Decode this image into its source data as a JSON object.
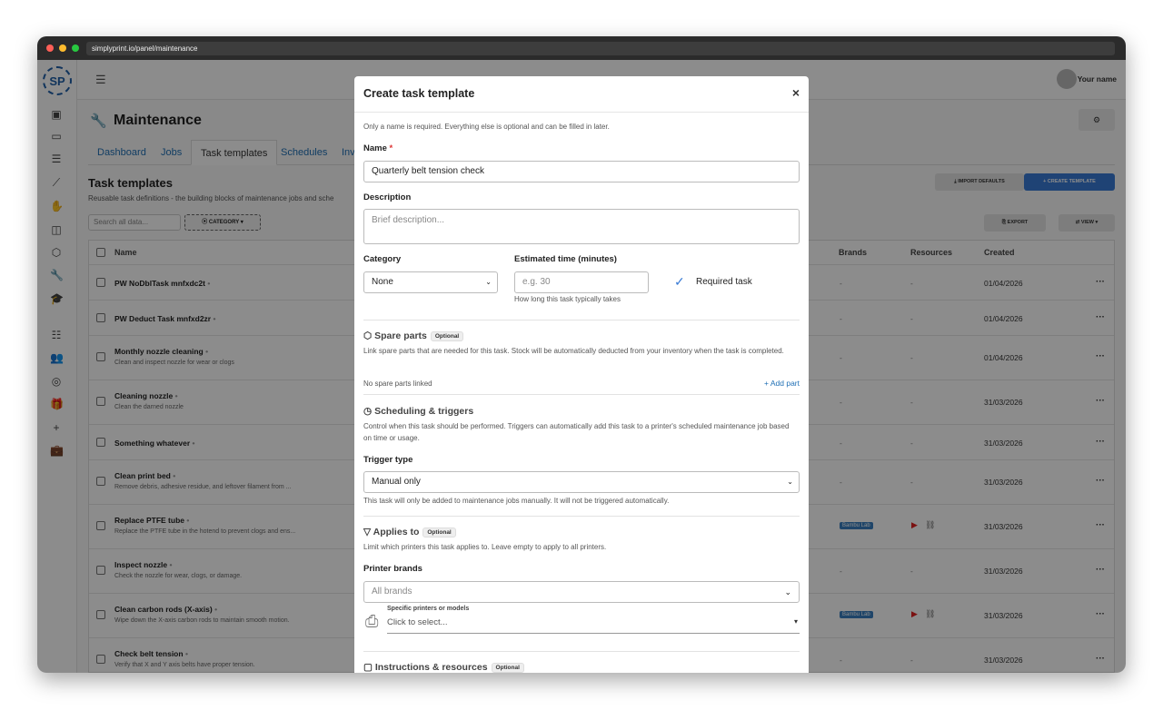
{
  "browser": {
    "url": "simplyprint.io/panel/maintenance"
  },
  "logo": {
    "text": "SP"
  },
  "topbar": {
    "user_name": "Your name"
  },
  "page": {
    "title": "Maintenance",
    "tabs": [
      "Dashboard",
      "Jobs",
      "Task templates",
      "Schedules",
      "Inv"
    ],
    "section_title": "Task templates",
    "section_subtitle": "Reusable task definitions - the building blocks of maintenance jobs and sche",
    "search_placeholder": "Search all data...",
    "category_button": "CATEGORY",
    "import_defaults": "IMPORT DEFAULTS",
    "create_template": "CREATE TEMPLATE",
    "export": "EXPORT",
    "view": "VIEW"
  },
  "table": {
    "headers": {
      "name": "Name",
      "brands": "Brands",
      "resources": "Resources",
      "created": "Created"
    },
    "rows": [
      {
        "name": "PW NoDblTask mnfxdc2t",
        "desc": "",
        "brand": "-",
        "resource": "-",
        "created": "01/04/2026"
      },
      {
        "name": "PW Deduct Task mnfxd2zr",
        "desc": "",
        "brand": "-",
        "resource": "-",
        "created": "01/04/2026"
      },
      {
        "name": "Monthly nozzle cleaning",
        "desc": "Clean and inspect nozzle for wear or clogs",
        "brand": "-",
        "resource": "-",
        "created": "01/04/2026"
      },
      {
        "name": "Cleaning nozzle",
        "desc": "Clean the darned nozzle",
        "brand": "-",
        "resource": "-",
        "created": "31/03/2026"
      },
      {
        "name": "Something whatever",
        "desc": "",
        "brand": "-",
        "resource": "-",
        "created": "31/03/2026"
      },
      {
        "name": "Clean print bed",
        "desc": "Remove debris, adhesive residue, and leftover filament from ...",
        "brand": "-",
        "resource": "-",
        "created": "31/03/2026"
      },
      {
        "name": "Replace PTFE tube",
        "desc": "Replace the PTFE tube in the hotend to prevent clogs and ens...",
        "brand": "Bambu Lab",
        "resource": "icons",
        "created": "31/03/2026"
      },
      {
        "name": "Inspect nozzle",
        "desc": "Check the nozzle for wear, clogs, or damage.",
        "brand": "-",
        "resource": "-",
        "created": "31/03/2026"
      },
      {
        "name": "Clean carbon rods (X-axis)",
        "desc": "Wipe down the X-axis carbon rods to maintain smooth motion.",
        "brand": "Bambu Lab",
        "resource": "icons",
        "created": "31/03/2026"
      },
      {
        "name": "Check belt tension",
        "desc": "Verify that X and Y axis belts have proper tension.",
        "brand": "-",
        "resource": "-",
        "created": "31/03/2026"
      }
    ]
  },
  "modal": {
    "title": "Create task template",
    "intro": "Only a name is required. Everything else is optional and can be filled in later.",
    "name_label": "Name",
    "name_required_mark": "*",
    "name_value": "Quarterly belt tension check",
    "description_label": "Description",
    "description_placeholder": "Brief description...",
    "category_label": "Category",
    "category_value": "None",
    "est_time_label": "Estimated time (minutes)",
    "est_time_placeholder": "e.g. 30",
    "est_time_help": "How long this task typically takes",
    "required_task_label": "Required task",
    "spare_parts_title": "Spare parts",
    "optional_badge": "Optional",
    "spare_parts_desc": "Link spare parts that are needed for this task. Stock will be automatically deducted from your inventory when the task is completed.",
    "no_spare_parts": "No spare parts linked",
    "add_part": "Add part",
    "scheduling_title": "Scheduling & triggers",
    "scheduling_desc": "Control when this task should be performed. Triggers can automatically add this task to a printer's scheduled maintenance job based on time or usage.",
    "trigger_type_label": "Trigger type",
    "trigger_type_value": "Manual only",
    "trigger_help": "This task will only be added to maintenance jobs manually. It will not be triggered automatically.",
    "applies_title": "Applies to",
    "applies_desc": "Limit which printers this task applies to. Leave empty to apply to all printers.",
    "printer_brands_label": "Printer brands",
    "printer_brands_value": "All brands",
    "specific_printers_label": "Specific printers or models",
    "specific_printers_value": "Click to select...",
    "instructions_title": "Instructions & resources"
  },
  "colors": {
    "accent": "#1f6fb5",
    "primary_button": "#3a7bd5",
    "badge": "#3a7fbf",
    "danger": "#d33"
  }
}
